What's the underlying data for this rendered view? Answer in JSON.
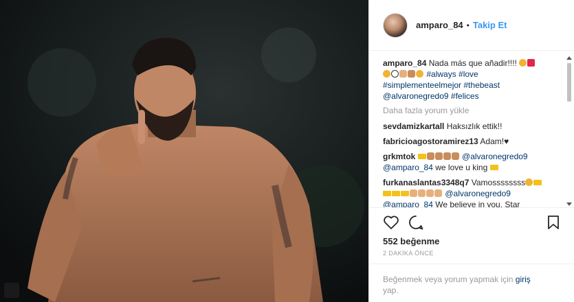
{
  "post": {
    "image_alt": "Player celebrating with finger on lips",
    "colors": {
      "accent": "#3897f0",
      "link": "#003569",
      "muted": "#999999",
      "text": "#262626"
    }
  },
  "header": {
    "username": "amparo_84",
    "separator": "•",
    "follow_label": "Takip Et"
  },
  "caption": {
    "username": "amparo_84",
    "text_before": "Nada más que añadir!!!!",
    "hashtags_line1": "#always #love",
    "hashtags_line2": "#simplementeelmejor #thebeast",
    "mentions_line": "@alvaronegredo9 #felices"
  },
  "load_more": "Daha fazla yorum yükle",
  "comments": [
    {
      "username": "sevdamizkartall",
      "text": "Haksızlık ettik!!"
    },
    {
      "username": "fabricioagostoramirez13",
      "text": "Adam!"
    },
    {
      "username": "grkmtok",
      "mention": "@alvaronegredo9",
      "mention2": "@amparo_84",
      "text": "we love u king"
    },
    {
      "username": "furkanaslantas3348q7",
      "text": "Vamossssssss",
      "mention": "@alvaronegredo9",
      "mention2": "@amparo_84",
      "text2": "We believe in you, Star"
    }
  ],
  "actions": {
    "like_icon": "heart-icon",
    "comment_icon": "comment-icon",
    "save_icon": "bookmark-icon"
  },
  "likes_text": "552 beğenme",
  "timestamp": "2 DAKİKA ÖNCE",
  "footer": {
    "text": "Beğenmek veya yorum yapmak için",
    "login_link": "giriş",
    "text_after": "yap."
  }
}
